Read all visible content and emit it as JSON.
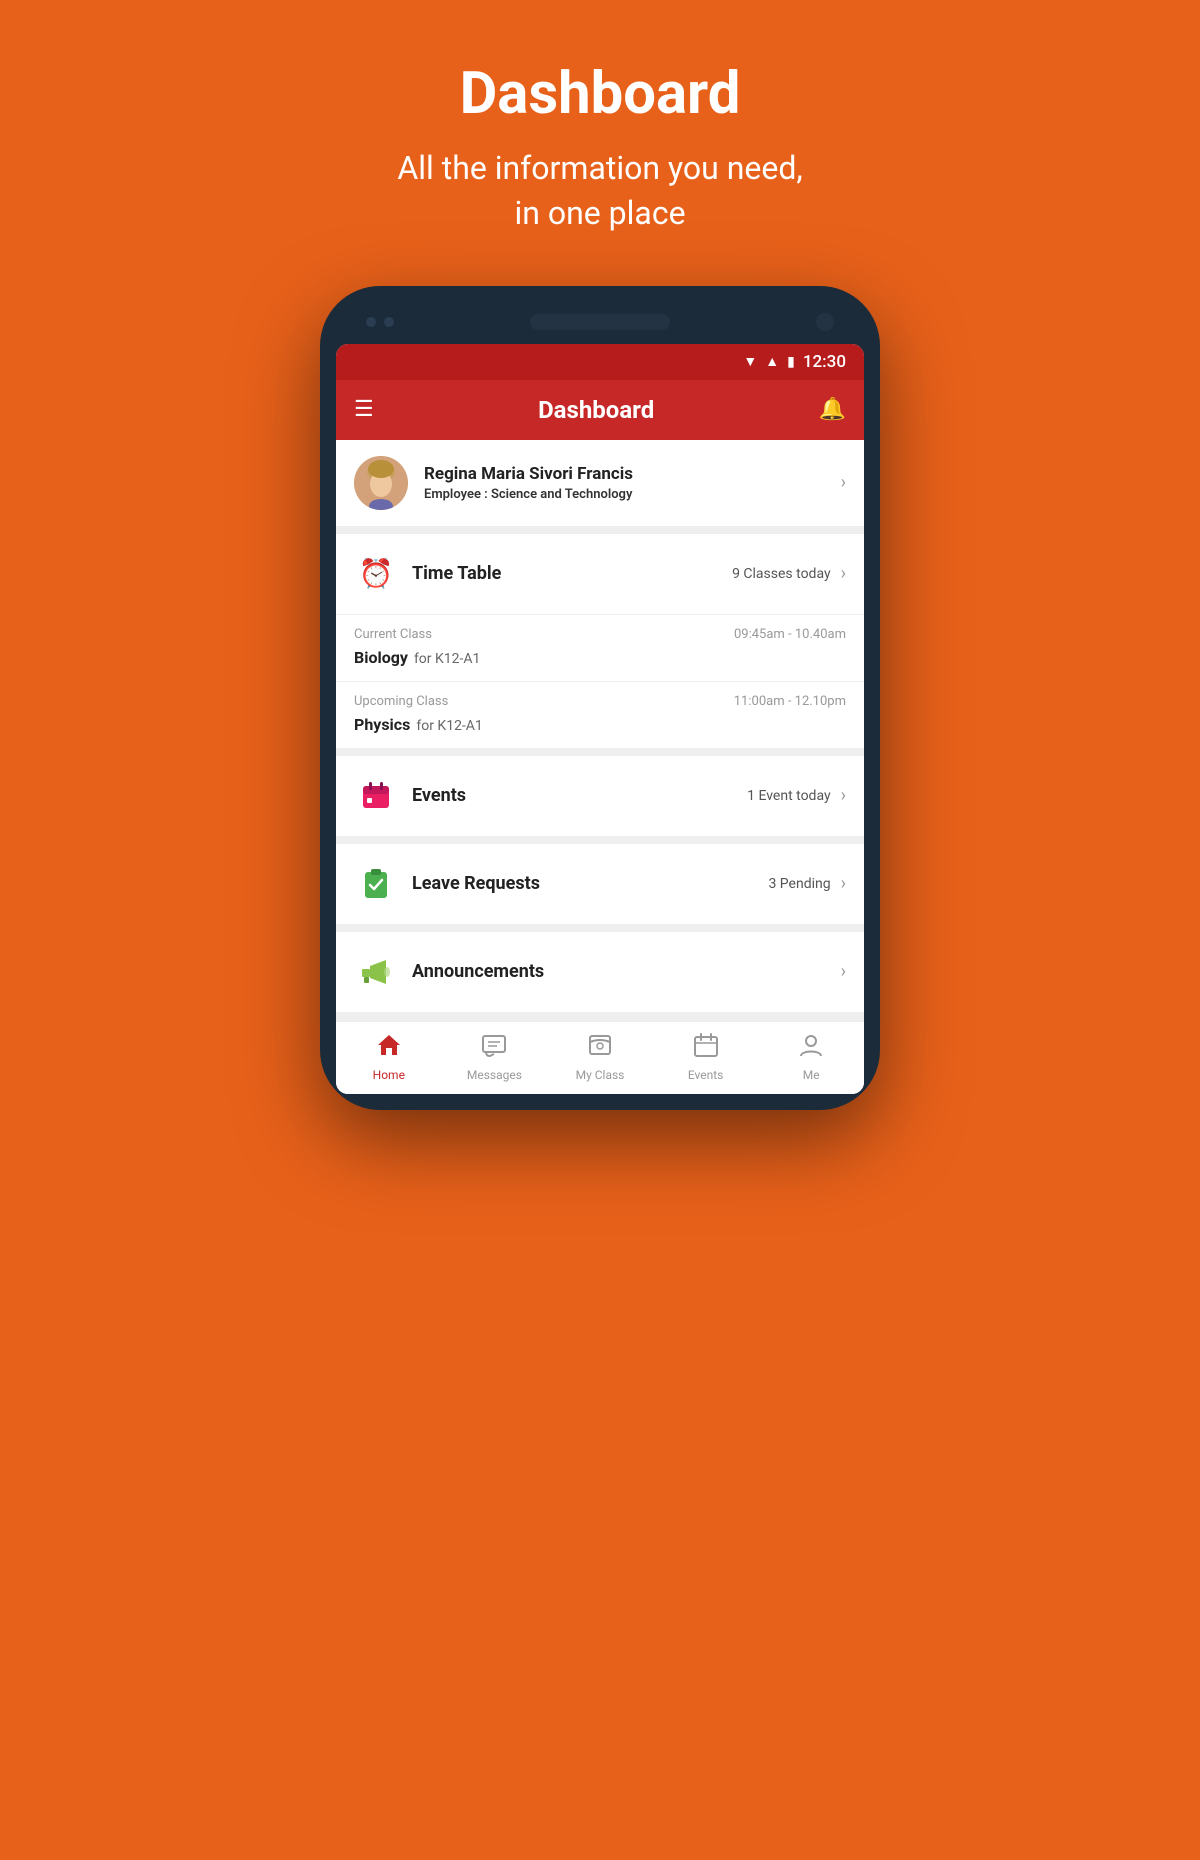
{
  "page": {
    "bg_color": "#E8611A",
    "header_title": "Dashboard",
    "header_subtitle": "All the information you need,\nin one place"
  },
  "status_bar": {
    "time": "12:30"
  },
  "app_bar": {
    "title": "Dashboard"
  },
  "profile": {
    "name": "Regina Maria Sivori Francis",
    "role_label": "Employee :",
    "role_value": "Science and Technology"
  },
  "timetable": {
    "icon": "⏰",
    "title": "Time Table",
    "count": "9 Classes today",
    "current_class": {
      "label": "Current Class",
      "time": "09:45am - 10.40am",
      "subject": "Biology",
      "group": "for K12-A1"
    },
    "upcoming_class": {
      "label": "Upcoming Class",
      "time": "11:00am - 12.10pm",
      "subject": "Physics",
      "group": "for K12-A1"
    }
  },
  "events": {
    "icon": "📅",
    "title": "Events",
    "count": "1 Event today"
  },
  "leave_requests": {
    "icon": "✅",
    "title": "Leave Requests",
    "count": "3 Pending"
  },
  "announcements": {
    "icon": "📢",
    "title": "Announcements",
    "count": ""
  },
  "bottom_nav": {
    "items": [
      {
        "id": "home",
        "label": "Home",
        "active": true
      },
      {
        "id": "messages",
        "label": "Messages",
        "active": false
      },
      {
        "id": "my-class",
        "label": "My Class",
        "active": false
      },
      {
        "id": "events",
        "label": "Events",
        "active": false
      },
      {
        "id": "me",
        "label": "Me",
        "active": false
      }
    ]
  }
}
